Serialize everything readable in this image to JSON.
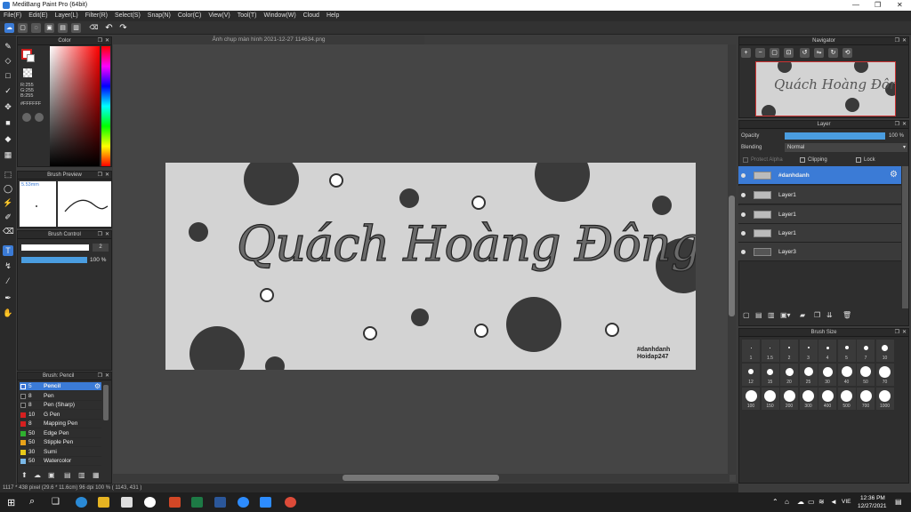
{
  "window": {
    "title": "MediBang Paint Pro (64bit)",
    "min": "—",
    "max": "❐",
    "close": "✕"
  },
  "menu": [
    "File(F)",
    "Edit(E)",
    "Layer(L)",
    "Filter(R)",
    "Select(S)",
    "Snap(N)",
    "Color(C)",
    "View(V)",
    "Tool(T)",
    "Window(W)",
    "Cloud",
    "Help"
  ],
  "document_tab": "Ảnh chụp màn hình 2021-12-27 114634.png",
  "color_panel": {
    "title": "Color",
    "r": "R:255",
    "g": "G:255",
    "b": "B:255",
    "hex": "#FFFFFF"
  },
  "brush_preview": {
    "title": "Brush Preview",
    "size": "5.53mm"
  },
  "brush_control": {
    "title": "Brush Control",
    "size_value": "2",
    "opacity_value": "100 %"
  },
  "brush_list": {
    "title": "Brush: Pencil",
    "items": [
      {
        "size": "5",
        "name": "Pencil",
        "color": "#3a6fd0"
      },
      {
        "size": "8",
        "name": "Pen",
        "color": "#222222"
      },
      {
        "size": "8",
        "name": "Pen (Sharp)",
        "color": "#222222"
      },
      {
        "size": "10",
        "name": "G Pen",
        "color": "#d62020"
      },
      {
        "size": "8",
        "name": "Mapping Pen",
        "color": "#d62020"
      },
      {
        "size": "50",
        "name": "Edge Pen",
        "color": "#2fb02f"
      },
      {
        "size": "50",
        "name": "Stipple Pen",
        "color": "#e8a21a"
      },
      {
        "size": "30",
        "name": "Sumi",
        "color": "#e8c91a"
      },
      {
        "size": "50",
        "name": "Watercolor",
        "color": "#7ab8e8"
      }
    ]
  },
  "canvas_text": {
    "headline": "Quách Hoàng Đông",
    "credit1": "#danhdanh",
    "credit2": "Hoidap247"
  },
  "navigator": {
    "title": "Navigator",
    "headline": "Quách Hoàng Đông"
  },
  "layer_panel": {
    "title": "Layer",
    "opacity_label": "Opacity",
    "opacity_value": "100 %",
    "opacity_fraction": 1.0,
    "blending_label": "Blending",
    "blending_value": "Normal",
    "protect_alpha": "Protect Alpha",
    "clipping": "Clipping",
    "lock": "Lock",
    "layers": [
      "#danhdanh",
      "Layer1",
      "Layer1",
      "Layer1",
      "Layer3"
    ]
  },
  "brush_size": {
    "title": "Brush Size",
    "row1": [
      "1",
      "1.5",
      "2",
      "3",
      "4",
      "5",
      "7",
      "10"
    ],
    "row2": [
      "12",
      "15",
      "20",
      "25",
      "30",
      "40",
      "50",
      "70"
    ],
    "row3": [
      "100",
      "150",
      "200",
      "300",
      "400",
      "500",
      "700",
      "1000"
    ]
  },
  "status": {
    "text": "1117 * 438 pixel   (29.6 * 11.6cm)   96 dpi   100 %   ( 1143, 431 )"
  },
  "taskbar": {
    "time": "12:36 PM",
    "date": "12/27/2021",
    "lang": "VIE"
  }
}
